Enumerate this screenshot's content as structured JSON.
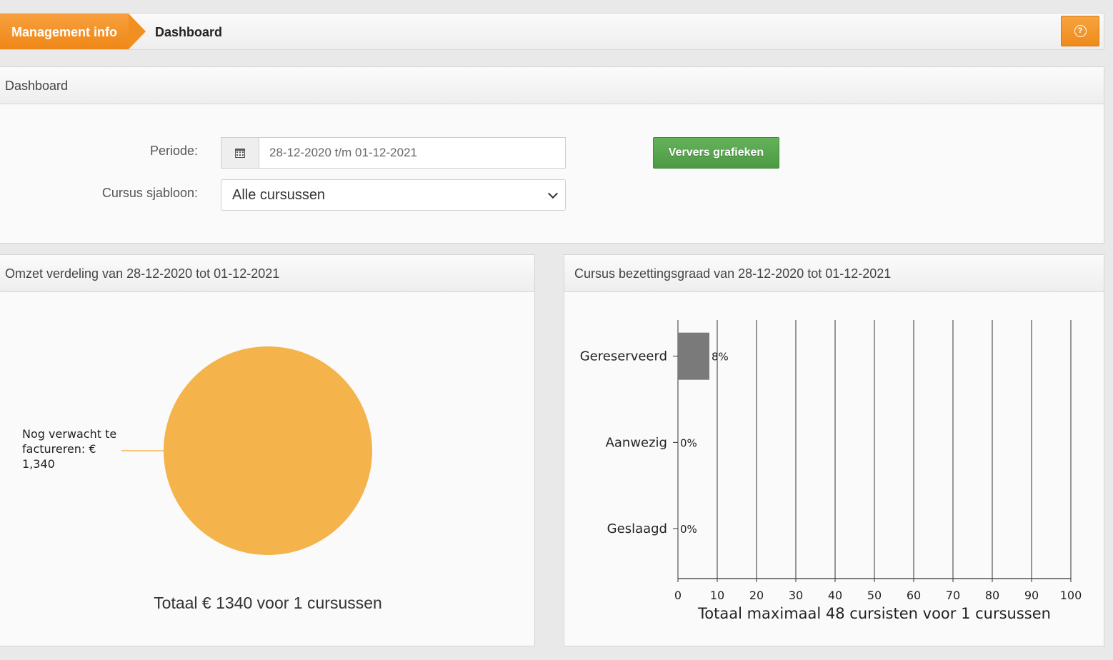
{
  "breadcrumb": {
    "home": "Management info",
    "current": "Dashboard"
  },
  "help_icon": "question-circle-icon",
  "filters": {
    "title": "Dashboard",
    "periode_label": "Periode:",
    "periode_value": "28-12-2020 t/m 01-12-2021",
    "sjabloon_label": "Cursus sjabloon:",
    "sjabloon_selected": "Alle cursussen",
    "refresh_button": "Ververs grafieken"
  },
  "omzet_panel": {
    "title": "Omzet verdeling van 28-12-2020 tot 01-12-2021",
    "total_text": "Totaal € 1340 voor 1 cursussen"
  },
  "bezetting_panel": {
    "title": "Cursus bezettingsgraad van 28-12-2020 tot 01-12-2021"
  },
  "chart_data": [
    {
      "type": "pie",
      "slices": [
        {
          "label_lines": [
            "Nog verwacht te",
            "factureren: €",
            "1,340"
          ],
          "value": 1340,
          "color": "#f4b34b"
        }
      ]
    },
    {
      "type": "bar",
      "orientation": "horizontal",
      "categories": [
        "Gereserveerd",
        "Aanwezig",
        "Geslaagd"
      ],
      "values": [
        8,
        0,
        0
      ],
      "value_labels": [
        "8%",
        "0%",
        "0%"
      ],
      "xlim": [
        0,
        100
      ],
      "xticks": [
        "0",
        "10",
        "20",
        "30",
        "40",
        "50",
        "60",
        "70",
        "80",
        "90",
        "100"
      ],
      "xlabel": "Totaal maximaal 48 cursisten voor 1 cursussen",
      "bar_color": "#7a7a7a",
      "grid": true
    }
  ]
}
